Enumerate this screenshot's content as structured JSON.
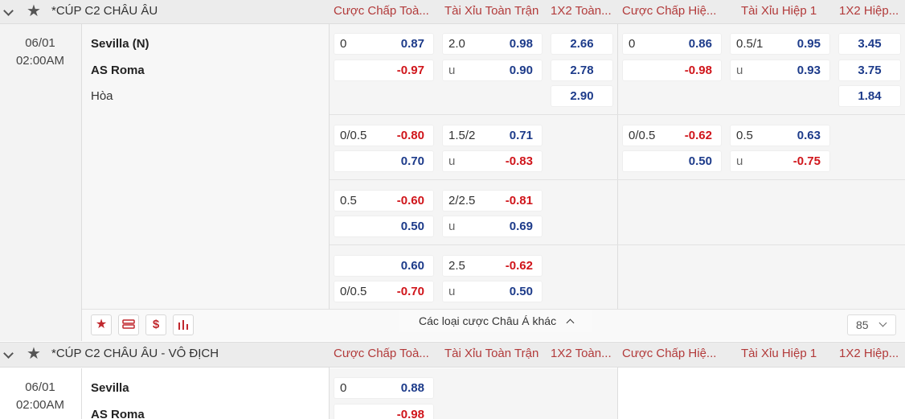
{
  "columns": [
    "Cược Chấp Toà...",
    "Tài Xỉu Toàn Trận",
    "1X2 Toàn...",
    "Cược Chấp Hiệ...",
    "Tài Xỉu Hiệp 1",
    "1X2 Hiệp..."
  ],
  "league1": {
    "name": "*CÚP C2 CHÂU ÂU",
    "date": "06/01",
    "time": "02:00AM",
    "home": "Sevilla (N)",
    "away": "AS Roma",
    "draw": "Hòa",
    "rows": [
      {
        "hdp_line": "0",
        "hdp_home": "0.87",
        "hdp_away": "-0.97",
        "ou_line": "2.0",
        "ou_over": "0.98",
        "ou_u": "u",
        "ou_under": "0.90",
        "x_home": "2.66",
        "x_away": "2.78",
        "x_draw": "2.90",
        "h_hdp_line": "0",
        "h_hdp_home": "0.86",
        "h_hdp_away": "-0.98",
        "h_ou_line": "0.5/1",
        "h_ou_over": "0.95",
        "h_ou_u": "u",
        "h_ou_under": "0.93",
        "h_x_home": "3.45",
        "h_x_away": "3.75",
        "h_x_draw": "1.84"
      },
      {
        "hdp_line": "0/0.5",
        "hdp_home": "-0.80",
        "hdp_away": "0.70",
        "ou_line": "1.5/2",
        "ou_over": "0.71",
        "ou_u": "u",
        "ou_under": "-0.83",
        "h_hdp_line": "0/0.5",
        "h_hdp_home": "-0.62",
        "h_hdp_away": "0.50",
        "h_ou_line": "0.5",
        "h_ou_over": "0.63",
        "h_ou_u": "u",
        "h_ou_under": "-0.75"
      },
      {
        "hdp_line": "0.5",
        "hdp_home": "-0.60",
        "hdp_away": "0.50",
        "ou_line": "2/2.5",
        "ou_over": "-0.81",
        "ou_u": "u",
        "ou_under": "0.69"
      },
      {
        "hdp_home": "0.60",
        "hdp_away_line": "0/0.5",
        "hdp_away": "-0.70",
        "ou_line": "2.5",
        "ou_over": "-0.62",
        "ou_u": "u",
        "ou_under": "0.50"
      }
    ],
    "more_label": "Các loại cược Châu Á khác",
    "page_count": "85"
  },
  "league2": {
    "name": "*CÚP C2 CHÂU ÂU - VÔ ĐỊCH",
    "date": "06/01",
    "time": "02:00AM",
    "home": "Sevilla",
    "away": "AS Roma",
    "hdp_line": "0",
    "hdp_home": "0.88",
    "hdp_away": "-0.98"
  },
  "icons": {
    "star": "star-icon",
    "list": "list-icon",
    "dollar": "dollar-icon",
    "stats": "stats-icon"
  },
  "colors": {
    "header_text": "#b23a3a",
    "positive": "#1d3b8a",
    "negative": "#d0151b"
  }
}
